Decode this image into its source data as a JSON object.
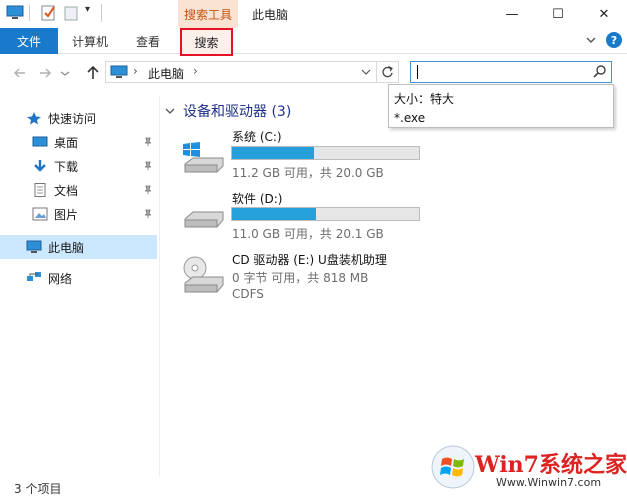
{
  "window": {
    "title": "此电脑",
    "context_tab_group": "搜索工具",
    "controls": {
      "minimize": "—",
      "maximize": "☐",
      "close": "✕"
    }
  },
  "ribbon": {
    "tabs": [
      {
        "label": "文件",
        "active": true
      },
      {
        "label": "计算机"
      },
      {
        "label": "查看"
      },
      {
        "label": "搜索",
        "highlighted": true
      }
    ],
    "help": "?"
  },
  "address": {
    "separator": "›",
    "path": "此电脑",
    "dropdown_chevron": "⌄"
  },
  "search": {
    "value": "",
    "suggestions": [
      "大小：特大",
      "*.exe"
    ]
  },
  "sidebar": {
    "quick_access": "快速访问",
    "items": [
      {
        "label": "桌面",
        "pinned": true
      },
      {
        "label": "下载",
        "pinned": true
      },
      {
        "label": "文档",
        "pinned": true
      },
      {
        "label": "图片",
        "pinned": true
      }
    ],
    "this_pc": "此电脑",
    "network": "网络"
  },
  "main": {
    "group_title": "设备和驱动器 (3)",
    "drives": [
      {
        "name": "系统 (C:)",
        "info": "11.2 GB 可用，共 20.0 GB",
        "used_fraction": 0.44
      },
      {
        "name": "软件 (D:)",
        "info": "11.0 GB 可用，共 20.1 GB",
        "used_fraction": 0.45
      },
      {
        "name": "CD 驱动器 (E:) U盘装机助理",
        "info": "0 字节 可用，共 818 MB",
        "fs": "CDFS"
      }
    ]
  },
  "status": {
    "count": "3 个项目"
  },
  "watermark": {
    "text": "Win7系统之家",
    "url": "Www.Winwin7.com"
  },
  "colors": {
    "accent": "#1979ca",
    "drive_fill": "#26a0da",
    "selection": "#cce8ff",
    "highlight_border": "#e81123"
  }
}
